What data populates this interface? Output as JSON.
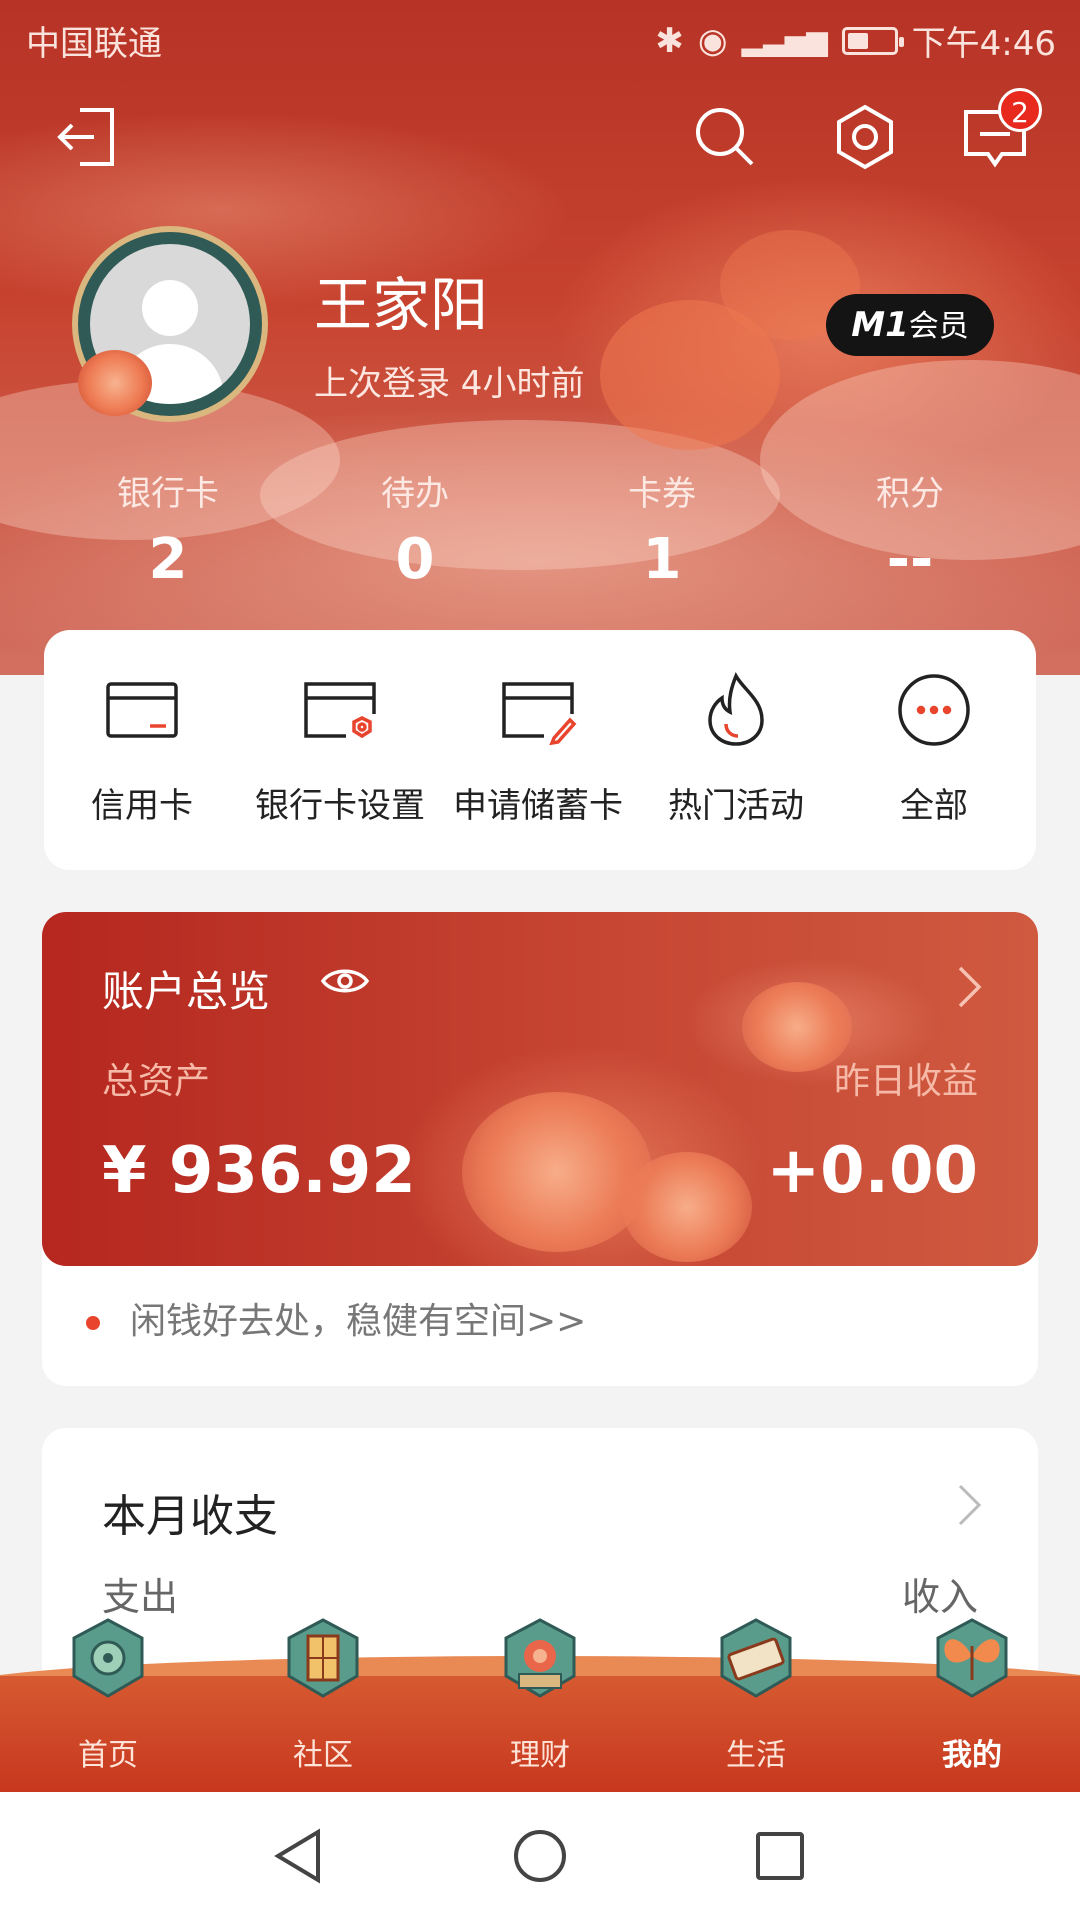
{
  "status_bar": {
    "carrier": "中国联通",
    "time": "下午4:46"
  },
  "header": {
    "notification_count": "2",
    "username": "王家阳",
    "last_login": "上次登录 4小时前",
    "member_badge_prefix": "M1",
    "member_badge_suffix": "会员"
  },
  "stats": [
    {
      "label": "银行卡",
      "value": "2"
    },
    {
      "label": "待办",
      "value": "0"
    },
    {
      "label": "卡券",
      "value": "1"
    },
    {
      "label": "积分",
      "value": "--"
    }
  ],
  "quick_actions": [
    {
      "label": "信用卡",
      "icon": "credit-card-icon"
    },
    {
      "label": "银行卡设置",
      "icon": "card-settings-icon"
    },
    {
      "label": "申请储蓄卡",
      "icon": "card-edit-icon"
    },
    {
      "label": "热门活动",
      "icon": "flame-icon"
    },
    {
      "label": "全部",
      "icon": "more-icon"
    }
  ],
  "account": {
    "title": "账户总览",
    "total_label": "总资产",
    "total_value": "¥ 936.92",
    "yesterday_label": "昨日收益",
    "yesterday_value": "+0.00",
    "promo": "闲钱好去处，稳健有空间>>"
  },
  "month": {
    "title": "本月收支",
    "expense_label": "支出",
    "income_label": "收入"
  },
  "bottom_nav": [
    {
      "label": "首页",
      "active": false
    },
    {
      "label": "社区",
      "active": false
    },
    {
      "label": "理财",
      "active": false
    },
    {
      "label": "生活",
      "active": false
    },
    {
      "label": "我的",
      "active": true
    }
  ],
  "colors": {
    "brand_red": "#c7432f",
    "badge_red": "#e8291e",
    "accent_dot": "#e8442e"
  }
}
